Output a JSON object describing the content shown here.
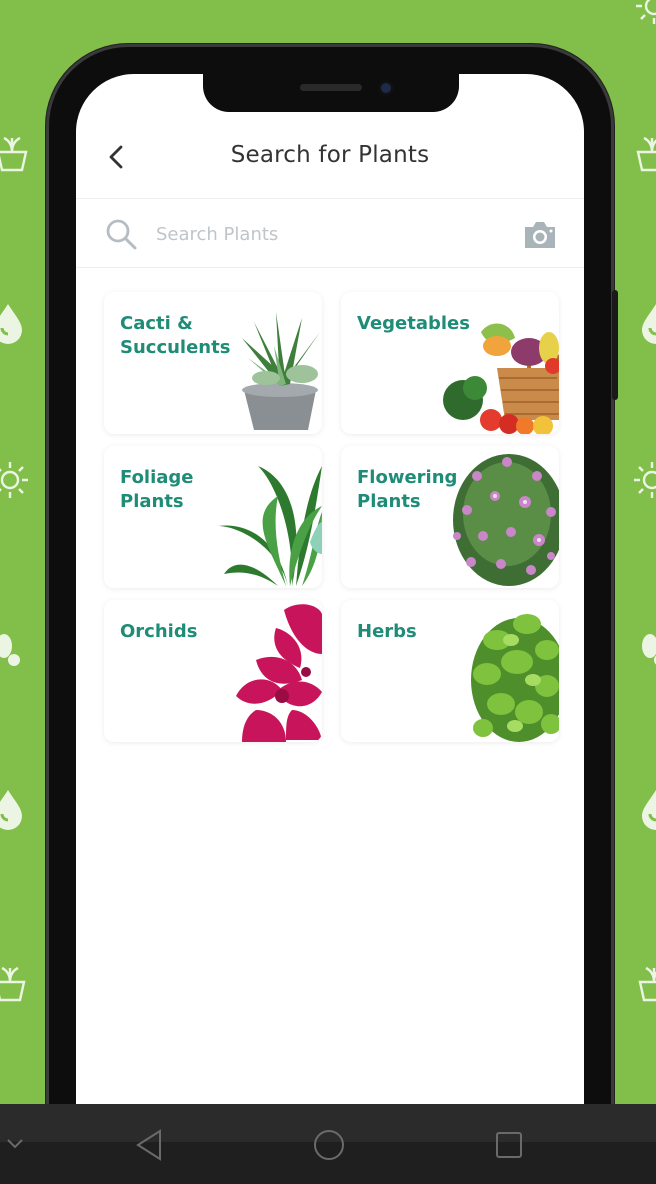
{
  "header": {
    "title": "Search for Plants"
  },
  "search": {
    "placeholder": "Search Plants",
    "value": ""
  },
  "categories": [
    {
      "label": "Cacti &\nSucculents",
      "image": "succulent-plant"
    },
    {
      "label": "Vegetables",
      "image": "vegetable-basket"
    },
    {
      "label": "Foliage\nPlants",
      "image": "foliage-plant"
    },
    {
      "label": "Flowering\nPlants",
      "image": "flowering-plant"
    },
    {
      "label": "Orchids",
      "image": "orchid-flower"
    },
    {
      "label": "Herbs",
      "image": "herb-plant"
    }
  ],
  "colors": {
    "background": "#82bf4a",
    "accent": "#1f8c78",
    "title_text": "#333333",
    "placeholder": "#bfc5c9"
  },
  "icons": {
    "back": "chevron-left-icon",
    "search": "search-icon",
    "camera": "camera-icon",
    "nav": [
      "chevron-down-icon",
      "back-triangle-icon",
      "home-circle-icon",
      "recents-square-icon"
    ]
  }
}
